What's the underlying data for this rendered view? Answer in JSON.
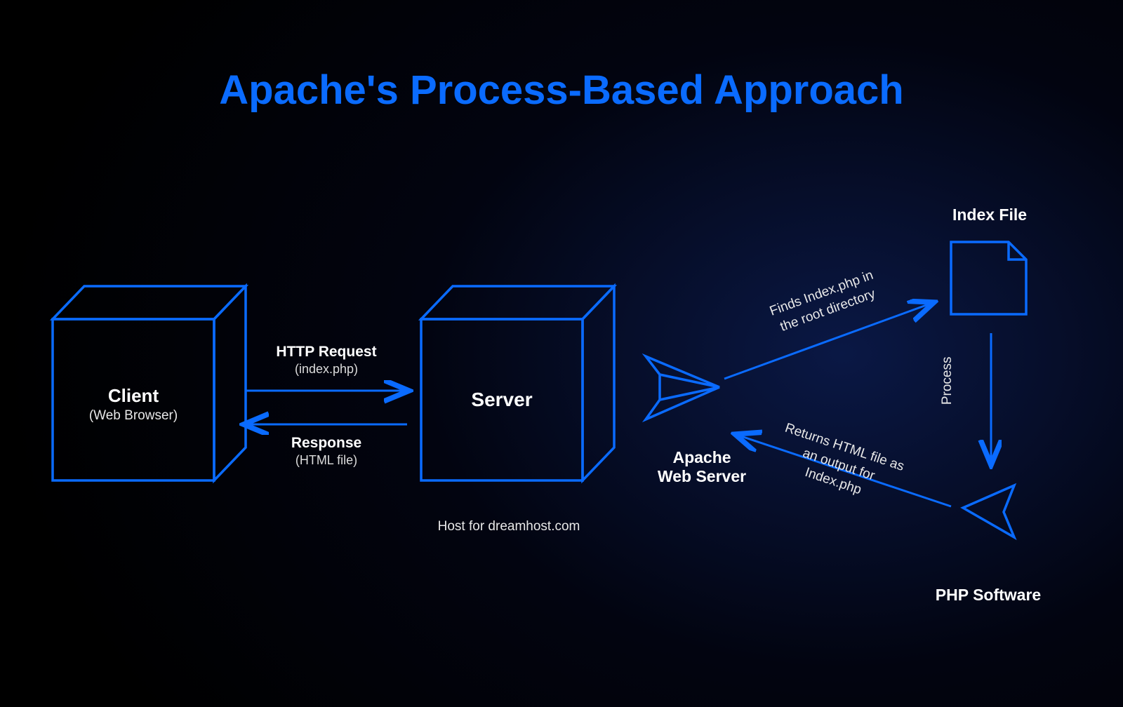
{
  "title": "Apache's Process-Based Approach",
  "client": {
    "title": "Client",
    "subtitle": "(Web Browser)"
  },
  "server": {
    "title": "Server",
    "caption": "Host for dreamhost.com"
  },
  "apache": {
    "line1": "Apache",
    "line2": "Web Server"
  },
  "indexFile": {
    "title": "Index File"
  },
  "php": {
    "title": "PHP Software"
  },
  "arrows": {
    "request": {
      "title": "HTTP Request",
      "sub": "(index.php)"
    },
    "response": {
      "title": "Response",
      "sub": "(HTML file)"
    },
    "findIndex": "Finds Index.php in\nthe root directory",
    "process": "Process",
    "returnsHtml": "Returns HTML file as\nan output for\nIndex.php"
  },
  "colors": {
    "accent": "#0a6bff",
    "stroke": "#0a6bff"
  }
}
